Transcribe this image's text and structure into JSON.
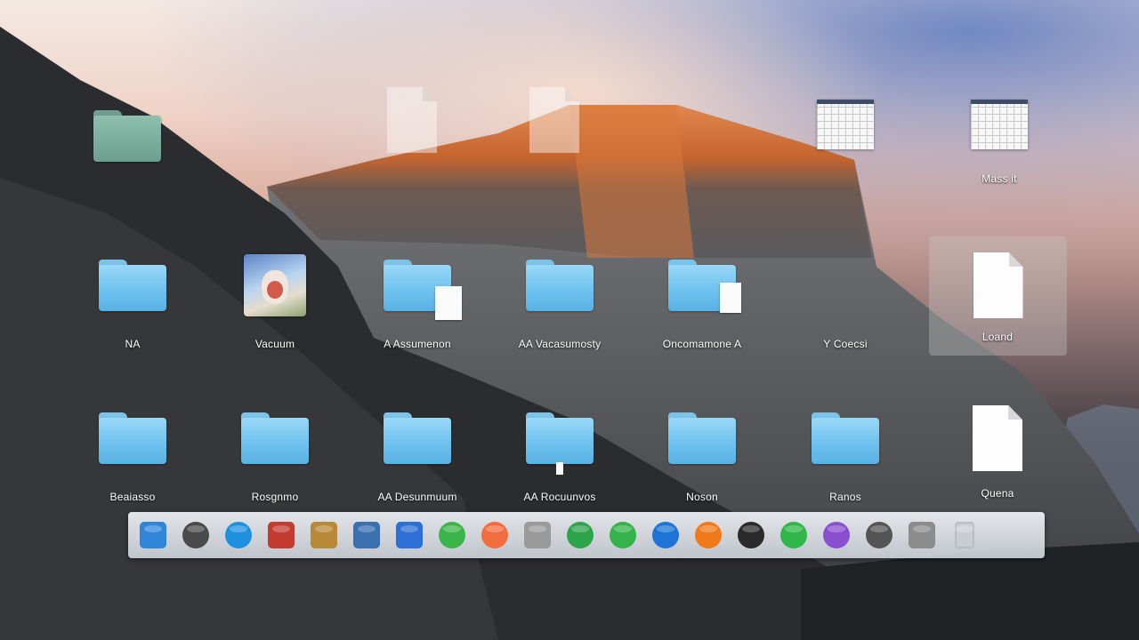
{
  "desktop": {
    "icons": [
      {
        "id": "folder-1",
        "kind": "folder-grey",
        "label": ""
      },
      {
        "id": "doc-faint-1",
        "kind": "doc-faint",
        "label": ""
      },
      {
        "id": "doc-faint-2",
        "kind": "doc-faint",
        "label": ""
      },
      {
        "id": "sheet-1",
        "kind": "sheet",
        "label": ""
      },
      {
        "id": "sheet-2",
        "kind": "sheet",
        "label": "Mass it"
      },
      {
        "id": "folder-2",
        "kind": "folder",
        "label": "NA"
      },
      {
        "id": "photo-1",
        "kind": "photo",
        "label": "Vacuum"
      },
      {
        "id": "folder-3",
        "kind": "folder-doc",
        "label": "A Assumenon"
      },
      {
        "id": "folder-4",
        "kind": "folder",
        "label": "AA Vacasumosty"
      },
      {
        "id": "folder-5",
        "kind": "folder-doc",
        "label": "Oncomamone A"
      },
      {
        "id": "file-1",
        "kind": "text",
        "label": "Y Coecsi"
      },
      {
        "id": "doc-1",
        "kind": "doc",
        "label": "Loand"
      },
      {
        "id": "folder-6",
        "kind": "folder",
        "label": "Beaiasso"
      },
      {
        "id": "folder-7",
        "kind": "folder",
        "label": "Rosgnmo"
      },
      {
        "id": "folder-8",
        "kind": "folder",
        "label": "AA Desunmuum"
      },
      {
        "id": "folder-9",
        "kind": "folder-doc",
        "label": "AA Rocuunvos"
      },
      {
        "id": "folder-10",
        "kind": "folder",
        "label": "Noson"
      },
      {
        "id": "folder-11",
        "kind": "folder",
        "label": "Ranos"
      },
      {
        "id": "doc-2",
        "kind": "doc",
        "label": "Quena"
      }
    ]
  },
  "dock": {
    "items": [
      {
        "name": "finder-icon",
        "color": "#2f86d8"
      },
      {
        "name": "launchpad-icon",
        "color": "#4a4a4a"
      },
      {
        "name": "safari-icon",
        "color": "#1f8fe0"
      },
      {
        "name": "mail-icon",
        "color": "#c43b32"
      },
      {
        "name": "notes-icon",
        "color": "#b88a38"
      },
      {
        "name": "preview-icon",
        "color": "#3a6fb0"
      },
      {
        "name": "contacts-icon",
        "color": "#2c6fd6"
      },
      {
        "name": "messages-icon",
        "color": "#3bb54a"
      },
      {
        "name": "photos-icon",
        "color": "#f26d3d"
      },
      {
        "name": "reminders-icon",
        "color": "#9a9a9a"
      },
      {
        "name": "numbers-icon",
        "color": "#2da34a"
      },
      {
        "name": "facetime-icon",
        "color": "#34b34a"
      },
      {
        "name": "app-store-icon",
        "color": "#1d73d6"
      },
      {
        "name": "ibooks-icon",
        "color": "#f07a1a"
      },
      {
        "name": "camera-icon",
        "color": "#2b2b2b"
      },
      {
        "name": "maps-icon",
        "color": "#2fb74a"
      },
      {
        "name": "podcasts-icon",
        "color": "#8a4fd0"
      },
      {
        "name": "chat-icon",
        "color": "#555555"
      },
      {
        "name": "system-preferences-icon",
        "color": "#8c8c8c"
      },
      {
        "name": "trash-icon",
        "color": "#c9cdd3"
      }
    ]
  }
}
